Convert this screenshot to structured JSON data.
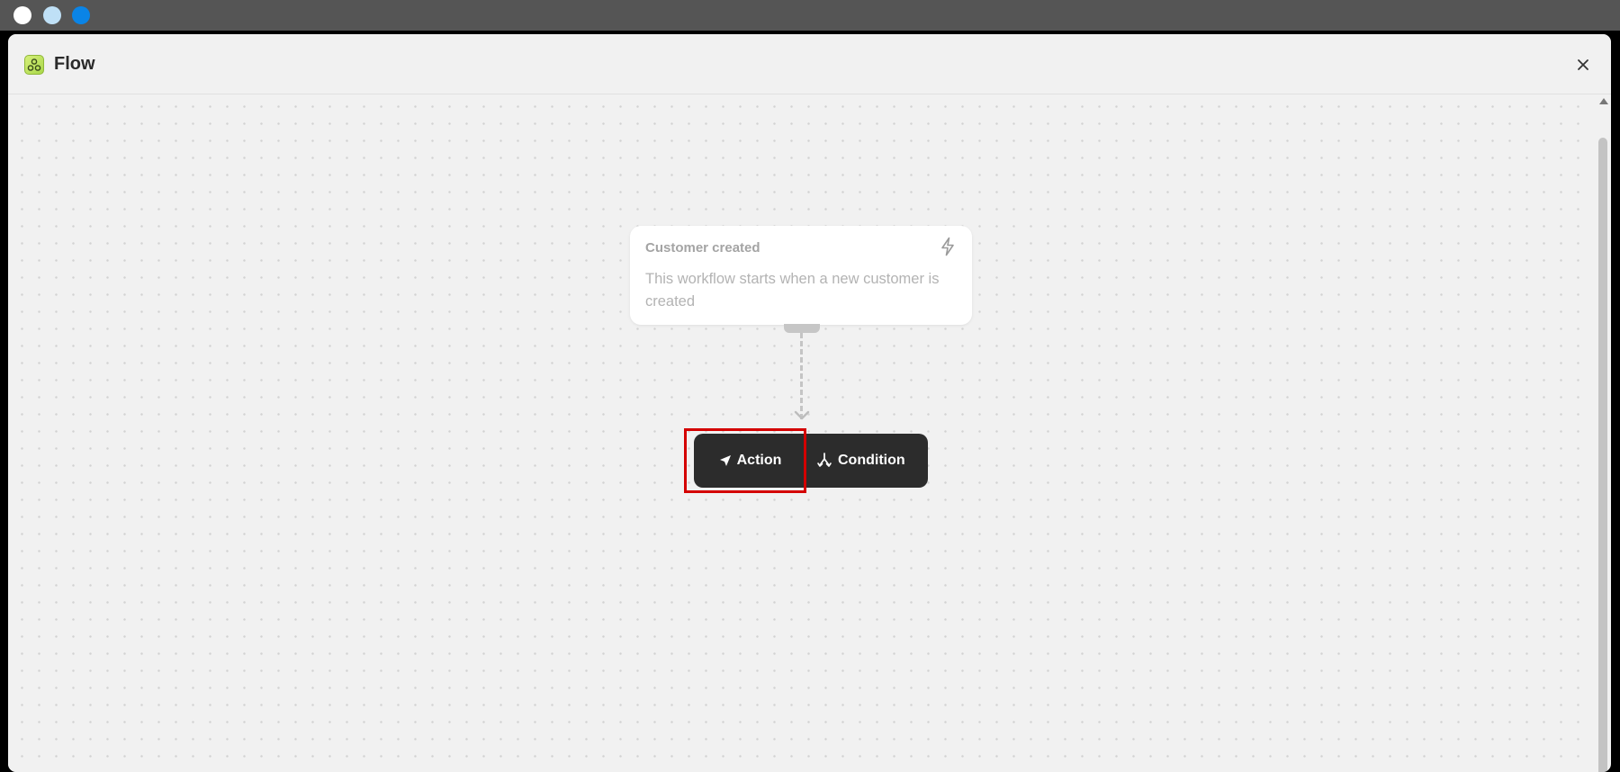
{
  "window": {
    "title": "Flow",
    "app_icon": "flow-app-icon",
    "close_icon": "close-icon"
  },
  "trigger": {
    "title": "Customer created",
    "description": "This workflow starts when a new customer is created",
    "icon": "lightning-bolt-icon"
  },
  "add_step": {
    "action_label": "Action",
    "action_icon": "navigation-arrow-icon",
    "condition_label": "Condition",
    "condition_icon": "branch-icon"
  },
  "colors": {
    "highlight": "#d40000",
    "button_bg": "#2c2c2c",
    "canvas_bg": "#f1f1f1"
  }
}
